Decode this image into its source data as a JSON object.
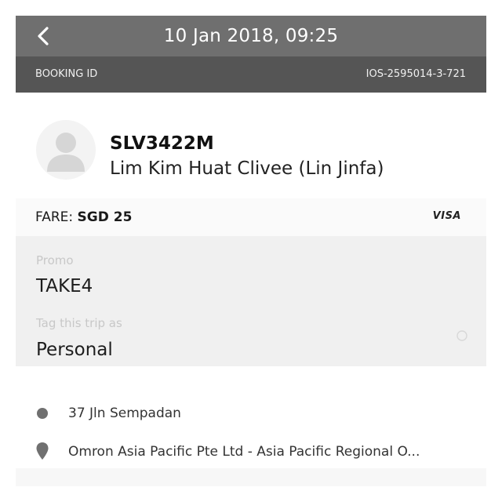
{
  "header": {
    "title": "10 Jan 2018, 09:25",
    "back_icon": "chevron-left-icon"
  },
  "booking": {
    "label": "BOOKING ID",
    "id": "IOS-2595014-3-721"
  },
  "driver": {
    "avatar_icon": "user-avatar-icon",
    "plate": "SLV3422M",
    "name": "Lim Kim Huat Clivee (Lin Jinfa)"
  },
  "fare": {
    "label": "FARE:",
    "amount": "SGD 25",
    "payment_method": "VISA"
  },
  "promo": {
    "label": "Promo",
    "value": "TAKE4"
  },
  "tag": {
    "label": "Tag this trip as",
    "value": "Personal",
    "toggle_icon": "dropdown-indicator-icon"
  },
  "route": {
    "pickup": "37 Jln Sempadan",
    "dropoff": "Omron Asia Pacific Pte Ltd - Asia Pacific Regional O...",
    "pickup_icon": "dot-icon",
    "dropoff_icon": "location-pin-icon"
  },
  "colors": {
    "header_bg": "#6f6f6f",
    "idbar_bg": "#555555",
    "fields_bg": "#f0f0f0"
  }
}
